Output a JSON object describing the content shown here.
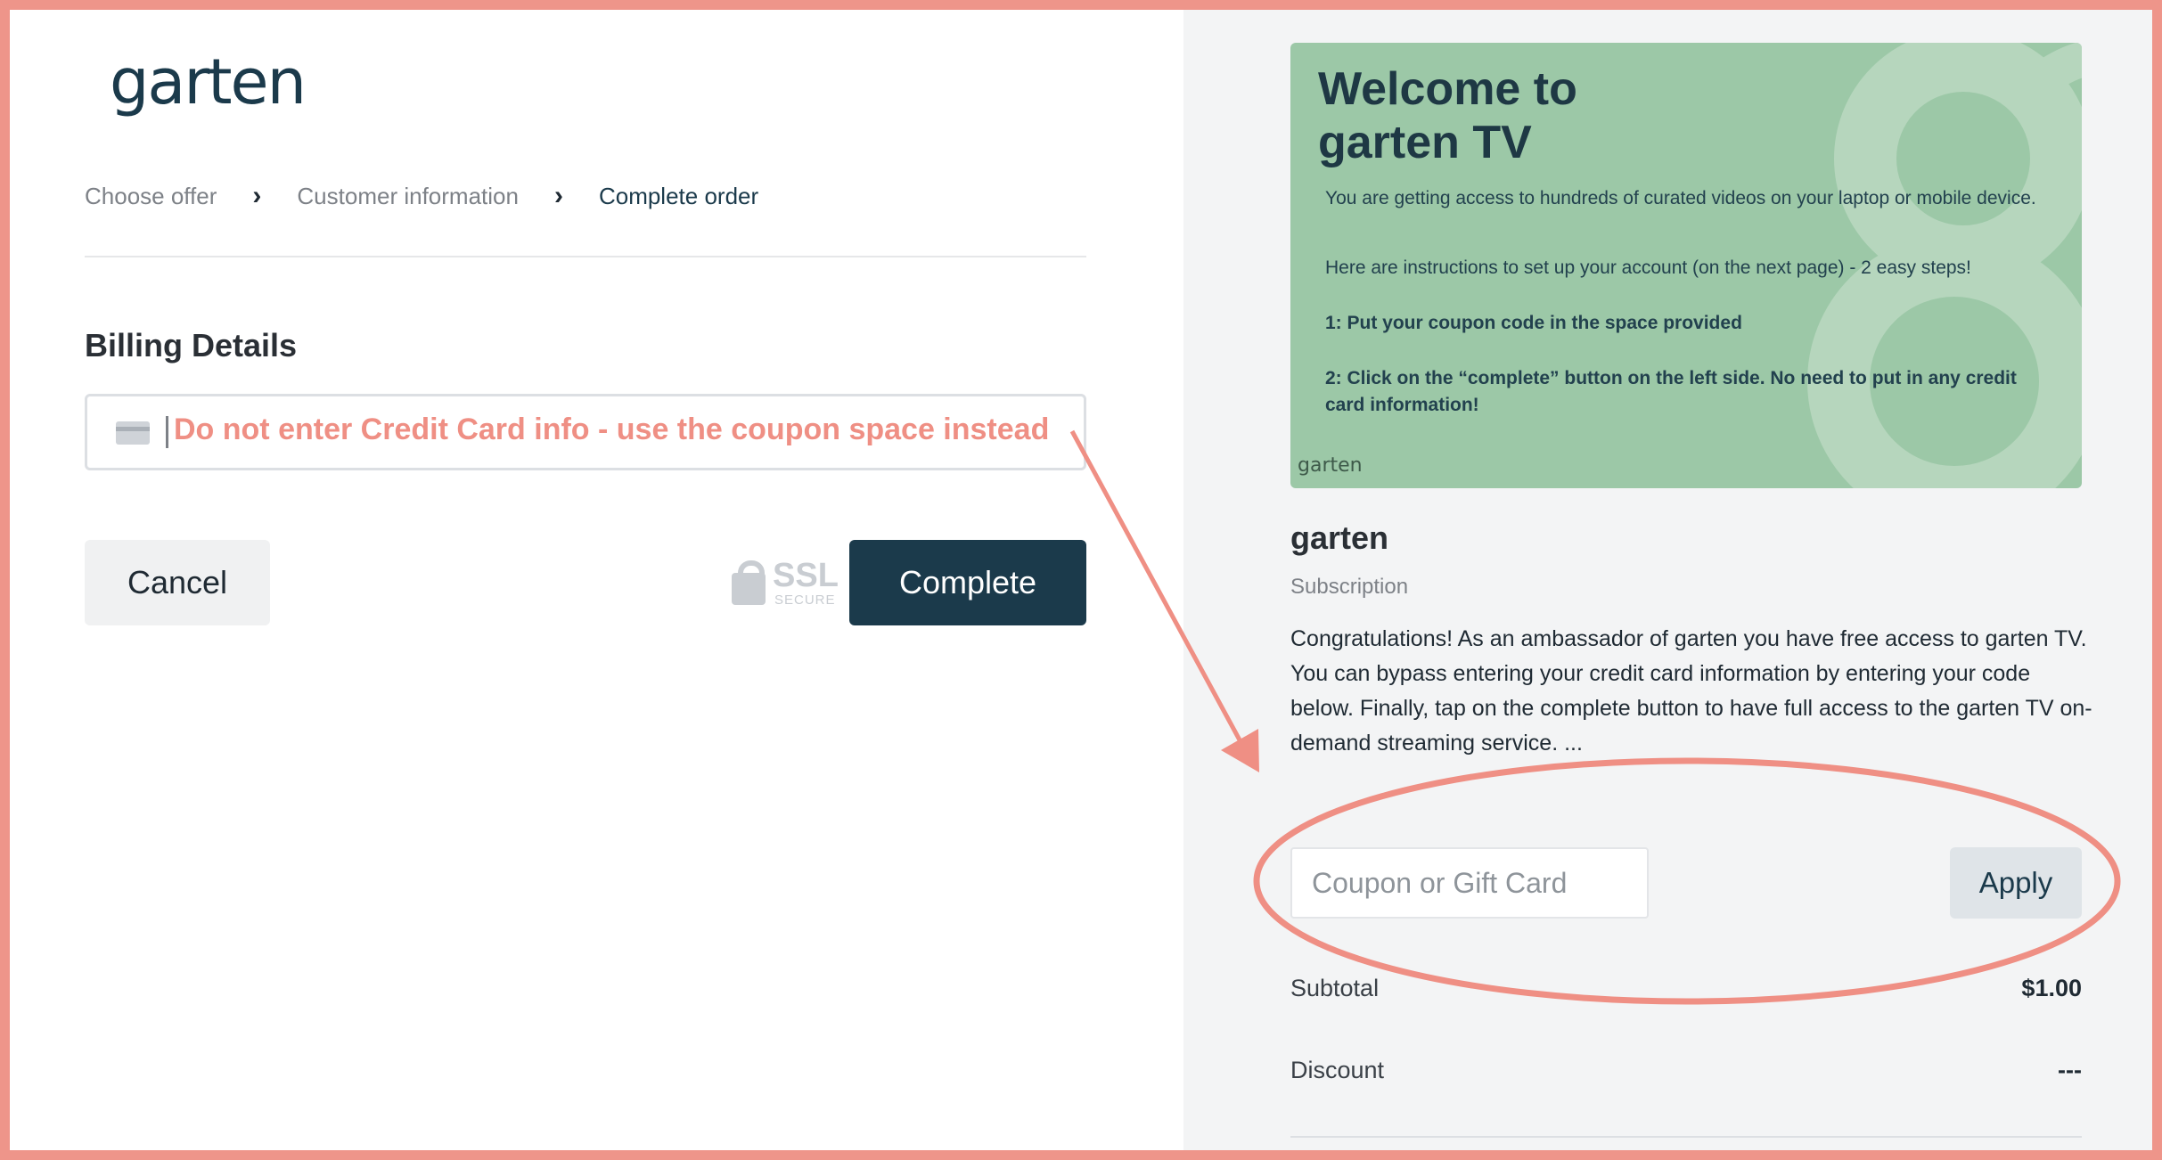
{
  "brand": {
    "logo_text": "garten"
  },
  "breadcrumb": [
    {
      "label": "Choose offer",
      "active": false
    },
    {
      "label": "Customer information",
      "active": false
    },
    {
      "label": "Complete order",
      "active": true
    }
  ],
  "billing": {
    "title": "Billing Details",
    "card_placeholder": "",
    "annotation": "Do not enter Credit Card info - use the coupon space instead"
  },
  "actions": {
    "cancel_label": "Cancel",
    "complete_label": "Complete",
    "ssl_label": "SSL",
    "ssl_sub": "SECURE"
  },
  "banner": {
    "title_line1": "Welcome to",
    "title_line2": "garten TV",
    "line1": "You are getting access to hundreds of curated videos on your laptop or mobile device.",
    "line2": "Here are instructions to set up your account (on the next page) - 2 easy steps!",
    "line3": "1: Put your coupon code in the space provided",
    "line4": "2: Click on the “complete” button on the left side.  No need to put in any credit card information!",
    "logo_text": "garten"
  },
  "product": {
    "name": "garten",
    "type": "Subscription",
    "description": "Congratulations! As an ambassador of garten you have free access to garten TV. You can bypass entering your credit card information by entering your code below. Finally, tap on the complete button to have full access to the garten TV on-demand streaming service. ..."
  },
  "coupon": {
    "placeholder": "Coupon or Gift Card",
    "value": "",
    "apply_label": "Apply"
  },
  "summary": {
    "subtotal_label": "Subtotal",
    "subtotal_value": "$1.00",
    "discount_label": "Discount",
    "discount_value": "---"
  },
  "colors": {
    "annotation": "#ee958a",
    "primary": "#1b3a4b",
    "banner": "#9cc8a7"
  }
}
